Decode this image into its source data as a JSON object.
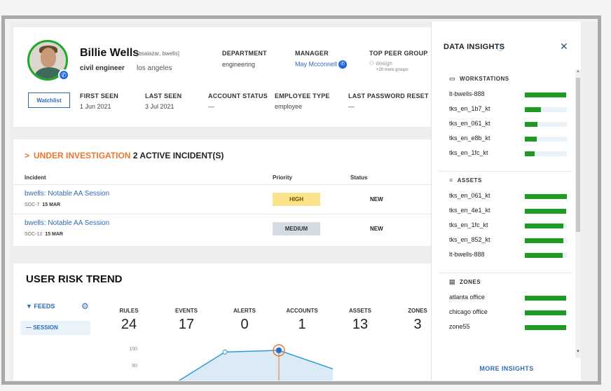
{
  "profile": {
    "name": "Billie Wells",
    "alias": "[bsalazar, bwells]",
    "title": "civil engineer",
    "location": "los angeles",
    "department_label": "DEPARTMENT",
    "department": "engineering",
    "manager_label": "MANAGER",
    "manager": "May Mcconnell",
    "peer_label": "TOP PEER GROUP",
    "peer_group": "design",
    "peer_more": "+20 more groups",
    "watchlist_label": "Watchlist",
    "first_seen_label": "FIRST SEEN",
    "first_seen": "1 Jun 2021",
    "last_seen_label": "LAST SEEN",
    "last_seen": "3 Jul 2021",
    "account_status_label": "ACCOUNT STATUS",
    "account_status": "—",
    "employee_type_label": "EMPLOYEE TYPE",
    "employee_type": "employee",
    "last_pw_label": "LAST PASSWORD RESET",
    "last_pw": "—"
  },
  "incidents": {
    "status_word": "UNDER INVESTIGATION",
    "count_text": "2 ACTIVE INCIDENT(S)",
    "col_incident": "Incident",
    "col_priority": "Priority",
    "col_status": "Status",
    "rows": [
      {
        "title": "bwells: Notable AA Session",
        "id": "SOC-7",
        "date": "15 MAR",
        "priority": "HIGH",
        "status": "NEW"
      },
      {
        "title": "bwells: Notable AA Session",
        "id": "SOC-12",
        "date": "15 MAR",
        "priority": "MEDIUM",
        "status": "NEW"
      }
    ]
  },
  "risk": {
    "title": "USER RISK TREND",
    "feeds_label": "FEEDS",
    "session_label": "— SESSION",
    "stats": [
      {
        "label": "RULES",
        "value": "24"
      },
      {
        "label": "EVENTS",
        "value": "17"
      },
      {
        "label": "ALERTS",
        "value": "0"
      },
      {
        "label": "ACCOUNTS",
        "value": "1"
      },
      {
        "label": "ASSETS",
        "value": "13"
      },
      {
        "label": "ZONES",
        "value": "3"
      }
    ],
    "y_ticks": [
      "100",
      "80"
    ]
  },
  "chart_data": {
    "type": "line",
    "ylim": [
      0,
      100
    ],
    "y_ticks": [
      100,
      80
    ],
    "series": [
      {
        "values": [
          58,
          98,
          100,
          78
        ]
      }
    ]
  },
  "insights": {
    "title": "DATA INSIGHTS",
    "more_label": "MORE INSIGHTS",
    "sections": [
      {
        "name": "WORKSTATIONS",
        "icon": "monitor-icon",
        "items": [
          {
            "label": "lt-bwells-888",
            "pct": 0.98
          },
          {
            "label": "tks_en_1b7_kt",
            "pct": 0.38
          },
          {
            "label": "tks_en_061_kt",
            "pct": 0.3
          },
          {
            "label": "tks_en_e8b_kt",
            "pct": 0.28
          },
          {
            "label": "tks_en_1fc_kt",
            "pct": 0.24
          }
        ]
      },
      {
        "name": "ASSETS",
        "icon": "list-icon",
        "items": [
          {
            "label": "tks_en_061_kt",
            "pct": 1.0
          },
          {
            "label": "tks_en_4e1_kt",
            "pct": 0.98
          },
          {
            "label": "tks_en_1fc_kt",
            "pct": 0.92
          },
          {
            "label": "tks_en_852_kt",
            "pct": 0.92
          },
          {
            "label": "lt-bwells-888",
            "pct": 0.9
          }
        ]
      },
      {
        "name": "ZONES",
        "icon": "zones-icon",
        "items": [
          {
            "label": "atlanta office",
            "pct": 0.98
          },
          {
            "label": "chicago office",
            "pct": 0.98
          },
          {
            "label": "zone55",
            "pct": 0.98
          }
        ]
      }
    ]
  },
  "colors": {
    "accent": "#2f6bb5",
    "investigation": "#e8772e",
    "bar": "#1e9a23",
    "high_bg": "#fbe38e",
    "medium_bg": "#d5dbe2"
  }
}
